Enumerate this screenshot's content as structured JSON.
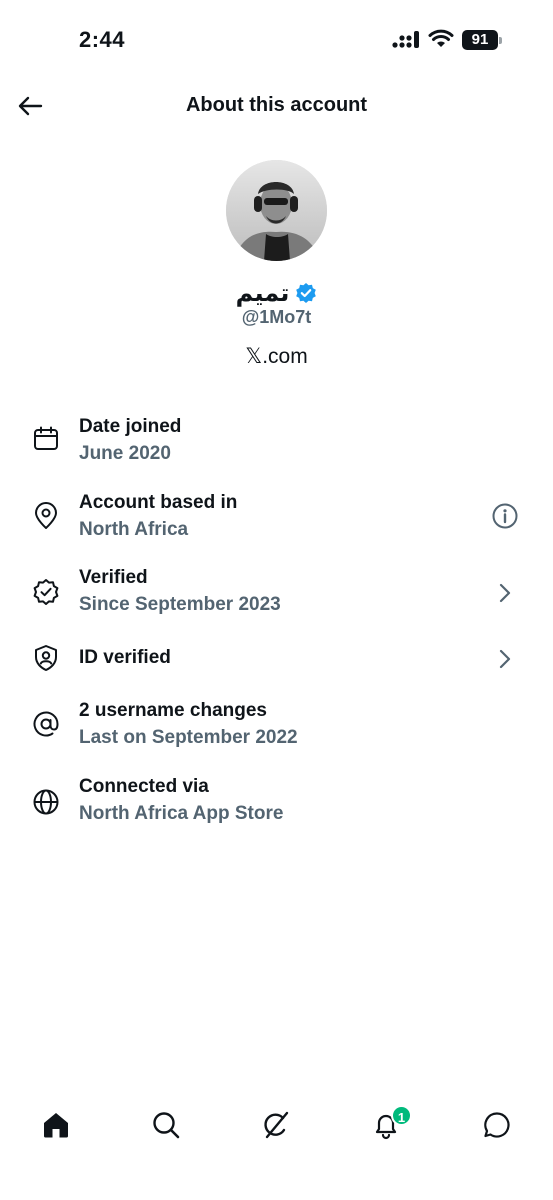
{
  "status_bar": {
    "time": "2:44",
    "battery": "91"
  },
  "header": {
    "title": "About this account"
  },
  "profile": {
    "display_name": "تميم",
    "handle": "@1Mo7t",
    "site": "𝕏.com",
    "verified_badge_color": "#1d9bf0"
  },
  "info_rows": [
    {
      "icon": "calendar-icon",
      "title": "Date joined",
      "subtitle": "June 2020"
    },
    {
      "icon": "location-pin-icon",
      "title": "Account based in",
      "subtitle": "North Africa",
      "action": "info-icon"
    },
    {
      "icon": "verified-badge-outline-icon",
      "title": "Verified",
      "subtitle": "Since September 2023",
      "action": "chevron-right-icon"
    },
    {
      "icon": "id-shield-icon",
      "title": "ID verified",
      "action": "chevron-right-icon"
    },
    {
      "icon": "at-sign-icon",
      "title": "2 username changes",
      "subtitle": "Last on September 2022"
    },
    {
      "icon": "globe-icon",
      "title": "Connected via",
      "subtitle": "North Africa App Store"
    }
  ],
  "bottom_nav": {
    "items": [
      "home-icon",
      "search-icon",
      "grok-icon",
      "notifications-icon",
      "messages-icon"
    ],
    "notifications_count": "1",
    "badge_color": "#00ba7c"
  },
  "colors": {
    "text": "#0f1419",
    "secondary": "#536471",
    "accent": "#1d9bf0"
  }
}
